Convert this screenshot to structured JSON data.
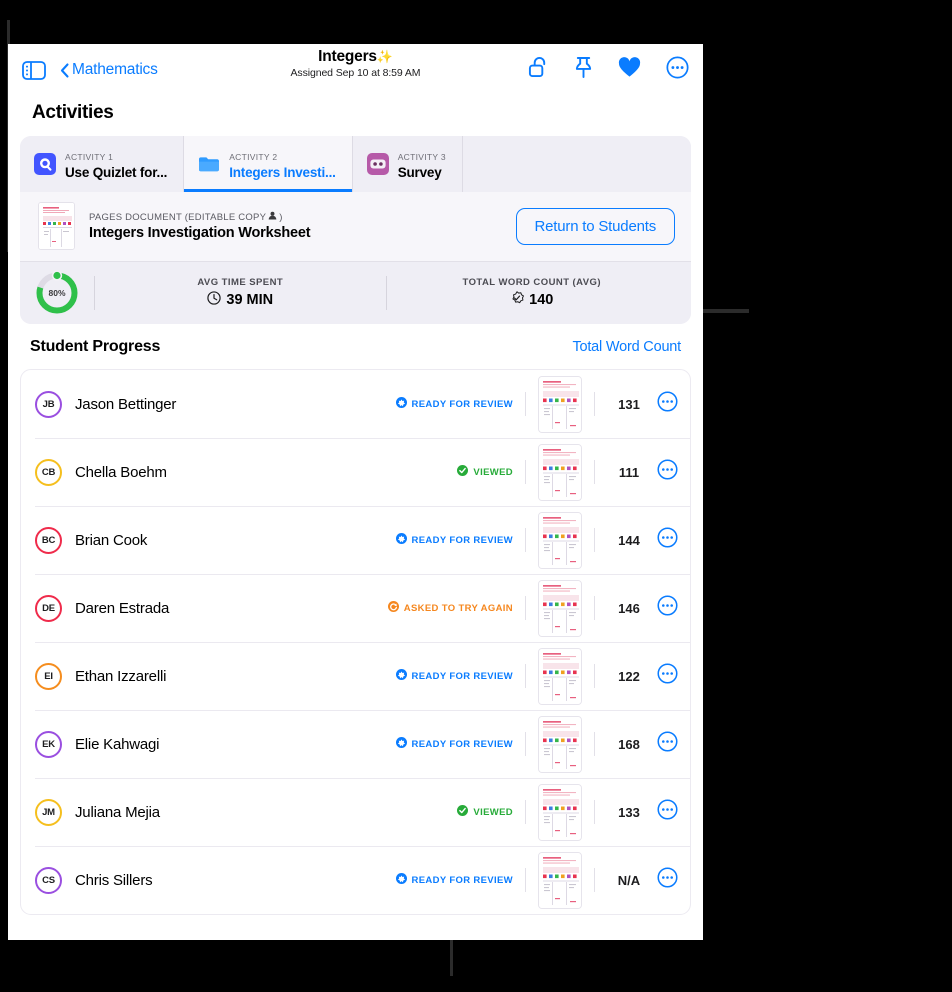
{
  "navbar": {
    "sidebar_toggle_icon": "sidebar-icon",
    "back_label": "Mathematics",
    "back_chevron_icon": "chevron-left-icon",
    "title": "Integers",
    "title_sparkle": "✨",
    "subtitle": "Assigned Sep 10 at 8:59 AM",
    "actions": [
      {
        "icon": "unlock-icon",
        "name": "unlock-button"
      },
      {
        "icon": "pin-icon",
        "name": "pin-button"
      },
      {
        "icon": "heart-icon",
        "name": "favorite-button"
      },
      {
        "icon": "more-circle-icon",
        "name": "more-options-button"
      }
    ]
  },
  "activities": {
    "section_title": "Activities",
    "tabs": [
      {
        "kicker": "ACTIVITY 1",
        "name": "Use Quizlet for...",
        "icon": "quizlet-icon",
        "active": false
      },
      {
        "kicker": "ACTIVITY 2",
        "name": "Integers Investi...",
        "icon": "folder-icon",
        "active": true
      },
      {
        "kicker": "ACTIVITY 3",
        "name": "Survey",
        "icon": "survey-icon",
        "active": false
      }
    ]
  },
  "document": {
    "thumbnail_icon": "document-thumbnail",
    "kicker": "PAGES DOCUMENT (EDITABLE COPY",
    "kicker_person_icon": "person-icon",
    "kicker_close": ")",
    "title": "Integers Investigation Worksheet",
    "return_button_label": "Return to Students"
  },
  "stats": {
    "ring_percent_label": "80%",
    "ring_percent_value": 80,
    "ring_color": "#2fc04a",
    "items": [
      {
        "label": "AVG TIME SPENT",
        "value": "39 MIN",
        "icon": "clock-icon"
      },
      {
        "label": "TOTAL WORD COUNT (AVG)",
        "value": "140",
        "icon": "checkmark-seal-icon"
      }
    ]
  },
  "progress": {
    "title": "Student Progress",
    "sort_label": "Total Word Count"
  },
  "students": [
    {
      "initials": "JB",
      "name": "Jason Bettinger",
      "ring_color": "#9a4fe0",
      "status": "READY FOR REVIEW",
      "status_type": "review",
      "word_count": "131"
    },
    {
      "initials": "CB",
      "name": "Chella Boehm",
      "ring_color": "#f5bf1e",
      "status": "VIEWED",
      "status_type": "viewed",
      "word_count": "111"
    },
    {
      "initials": "BC",
      "name": "Brian Cook",
      "ring_color": "#ef2b4b",
      "status": "READY FOR REVIEW",
      "status_type": "review",
      "word_count": "144"
    },
    {
      "initials": "DE",
      "name": "Daren Estrada",
      "ring_color": "#ef2b4b",
      "status": "ASKED TO TRY AGAIN",
      "status_type": "tryagain",
      "word_count": "146"
    },
    {
      "initials": "EI",
      "name": "Ethan Izzarelli",
      "ring_color": "#f58d1e",
      "status": "READY FOR REVIEW",
      "status_type": "review",
      "word_count": "122"
    },
    {
      "initials": "EK",
      "name": "Elie Kahwagi",
      "ring_color": "#9a4fe0",
      "status": "READY FOR REVIEW",
      "status_type": "review",
      "word_count": "168"
    },
    {
      "initials": "JM",
      "name": "Juliana Mejia",
      "ring_color": "#f5bf1e",
      "status": "VIEWED",
      "status_type": "viewed",
      "word_count": "133"
    },
    {
      "initials": "CS",
      "name": "Chris Sillers",
      "ring_color": "#9a4fe0",
      "status": "READY FOR REVIEW",
      "status_type": "review",
      "word_count": "N/A"
    }
  ],
  "colors": {
    "accent_blue": "#0a7cff",
    "green": "#27ab39",
    "orange": "#f5871f",
    "panel_bg": "#efeef5"
  }
}
